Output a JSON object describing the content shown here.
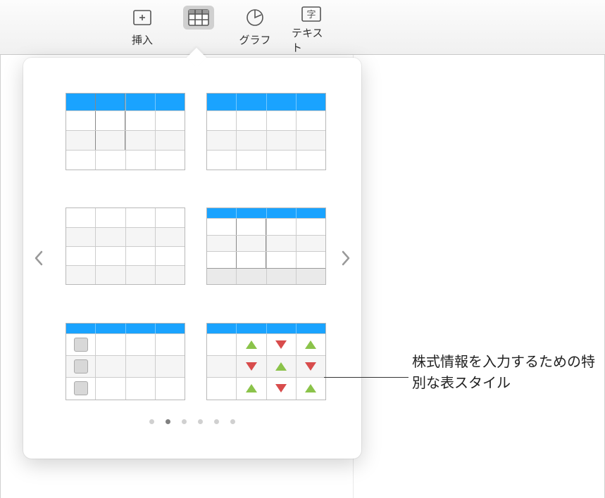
{
  "toolbar": {
    "insert_label": "挿入",
    "table_label": "",
    "chart_label": "グラフ",
    "text_label": "テキスト"
  },
  "popover": {
    "page_count": 6,
    "active_page": 2
  },
  "callout": {
    "text": "株式情報を入力するための特別な表スタイル"
  }
}
